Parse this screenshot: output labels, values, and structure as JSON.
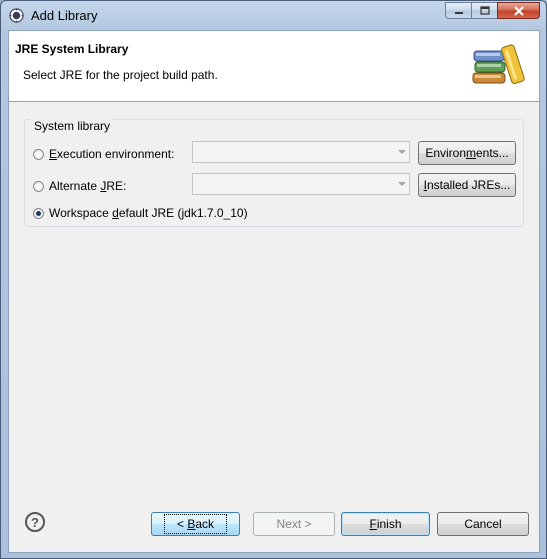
{
  "window": {
    "title": "Add Library"
  },
  "header": {
    "title": "JRE System Library",
    "description": "Select JRE for the project build path."
  },
  "group": {
    "label": "System library",
    "options": [
      {
        "pre": "",
        "mn": "E",
        "post": "xecution environment:",
        "checked": false
      },
      {
        "pre": "Alternate ",
        "mn": "J",
        "post": "RE:",
        "checked": false
      },
      {
        "pre": "Workspace ",
        "mn": "d",
        "post": "efault JRE (jdk1.7.0_10)",
        "checked": true
      }
    ],
    "environments_button": {
      "pre": "Environ",
      "mn": "m",
      "post": "ents..."
    },
    "installed_button": {
      "pre": "",
      "mn": "I",
      "post": "nstalled JREs..."
    },
    "execution_combo_value": "",
    "alternate_combo_value": ""
  },
  "footer": {
    "help_icon": "?",
    "back": {
      "pre": "< ",
      "mn": "B",
      "post": "ack"
    },
    "next": {
      "pre": "",
      "mn": "",
      "post": "Next >"
    },
    "finish": {
      "pre": "",
      "mn": "F",
      "post": "inish"
    },
    "cancel": {
      "pre": "Cancel",
      "mn": "",
      "post": ""
    }
  },
  "icons": {
    "app": "eclipse-icon",
    "banner": "library-books-icon"
  }
}
